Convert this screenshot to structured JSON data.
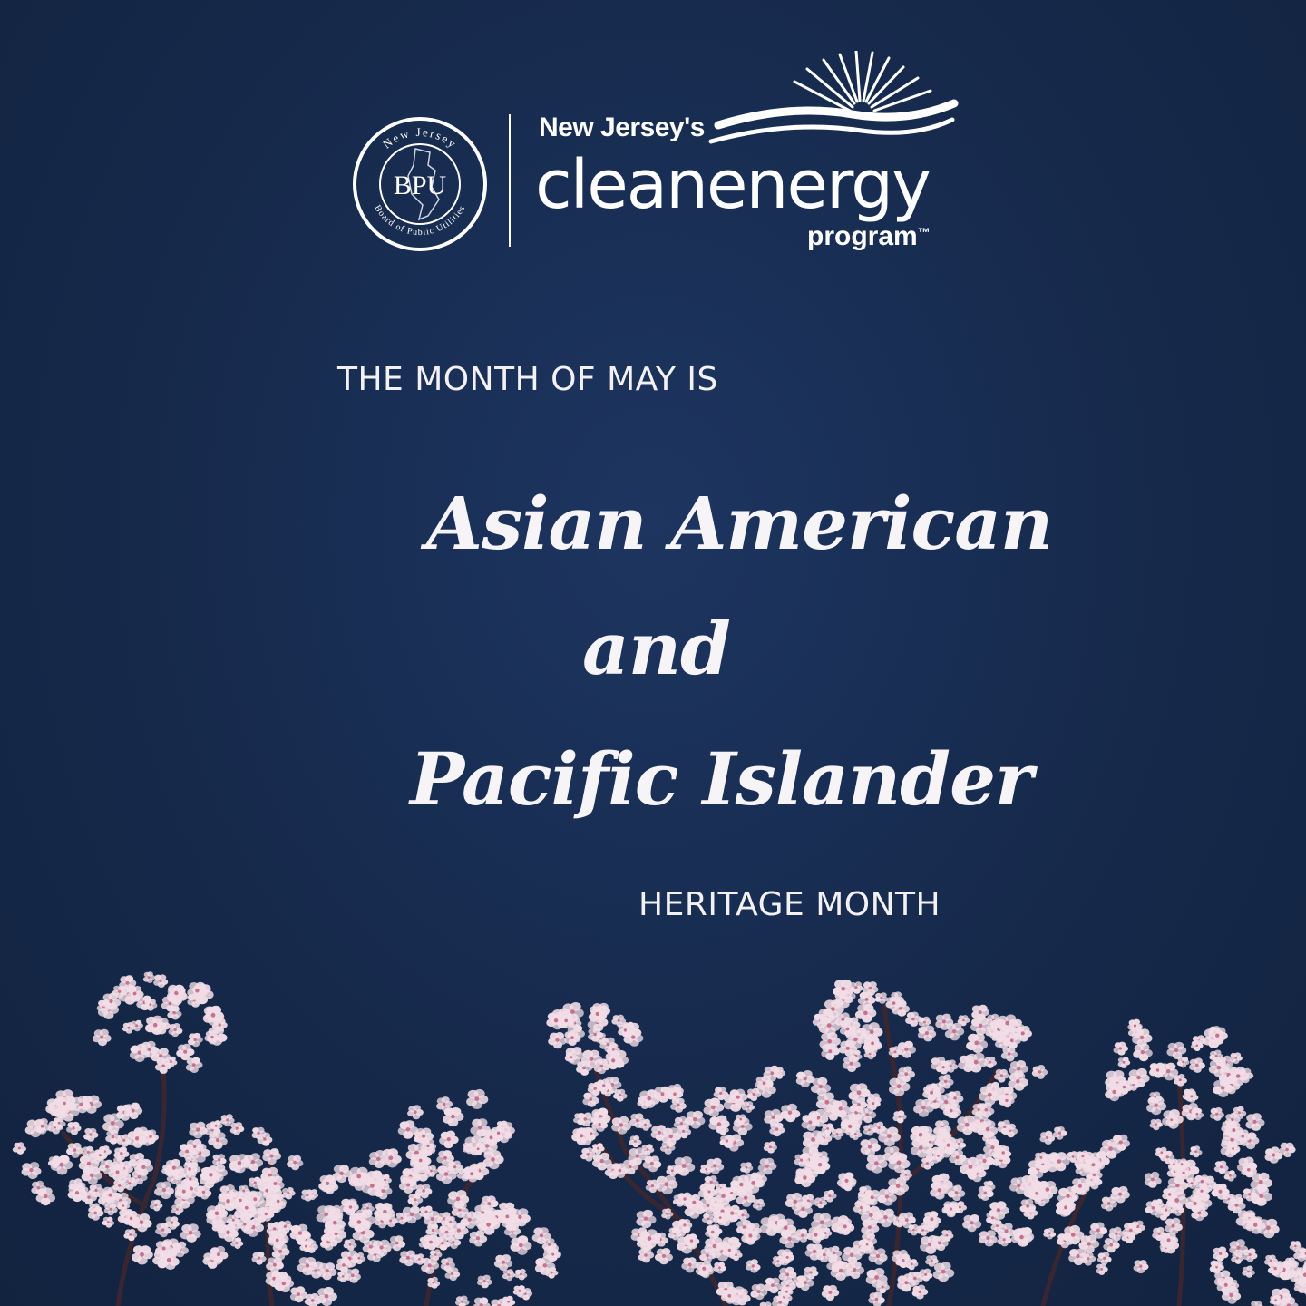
{
  "logo": {
    "seal_top_text": "New Jersey",
    "seal_center_text": "BPU",
    "seal_bottom_text": "Board of Public Utilities",
    "program_prefix": "New Jersey's",
    "program_name": "cleanenergy",
    "program_suffix": "program",
    "trademark": "™"
  },
  "message": {
    "intro": "THE MONTH OF MAY IS",
    "line1": "Asian American",
    "line2": "and",
    "line3": "Pacific Islander",
    "outro": "HERITAGE MONTH"
  },
  "colors": {
    "background": "#17294a",
    "text": "#f4f1f4",
    "blossom": "#f1dde6"
  },
  "icons": {
    "seal": "nj-bpu-seal-icon",
    "sun": "sunburst-icon",
    "flowers": "cherry-blossom-icon"
  }
}
